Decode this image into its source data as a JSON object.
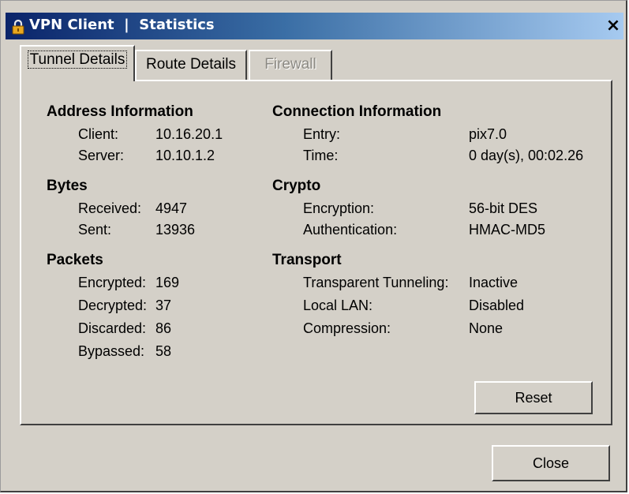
{
  "window": {
    "title": "VPN Client  |  Statistics",
    "close_glyph": "×"
  },
  "tabs": [
    {
      "label": "Tunnel Details",
      "active": true
    },
    {
      "label": "Route Details",
      "active": false
    },
    {
      "label": "Firewall",
      "active": false,
      "disabled": true
    }
  ],
  "address_info": {
    "heading": "Address Information",
    "client_label": "Client:",
    "client_value": "10.16.20.1",
    "server_label": "Server:",
    "server_value": "10.10.1.2"
  },
  "connection_info": {
    "heading": "Connection Information",
    "entry_label": "Entry:",
    "entry_value": "pix7.0",
    "time_label": "Time:",
    "time_value": "0 day(s), 00:02.26"
  },
  "bytes": {
    "heading": "Bytes",
    "received_label": "Received:",
    "received_value": "4947",
    "sent_label": "Sent:",
    "sent_value": "13936"
  },
  "crypto": {
    "heading": "Crypto",
    "encryption_label": "Encryption:",
    "encryption_value": "56-bit DES",
    "authentication_label": "Authentication:",
    "authentication_value": "HMAC-MD5"
  },
  "packets": {
    "heading": "Packets",
    "encrypted_label": "Encrypted:",
    "encrypted_value": "169",
    "decrypted_label": "Decrypted:",
    "decrypted_value": "37",
    "discarded_label": "Discarded:",
    "discarded_value": "86",
    "bypassed_label": "Bypassed:",
    "bypassed_value": "58"
  },
  "transport": {
    "heading": "Transport",
    "transparent_label": "Transparent Tunneling:",
    "transparent_value": "Inactive",
    "local_lan_label": "Local LAN:",
    "local_lan_value": "Disabled",
    "compression_label": "Compression:",
    "compression_value": "None"
  },
  "buttons": {
    "reset": "Reset",
    "close": "Close"
  },
  "icons": {
    "app_icon": "lock-icon",
    "close_icon": "close-icon"
  }
}
